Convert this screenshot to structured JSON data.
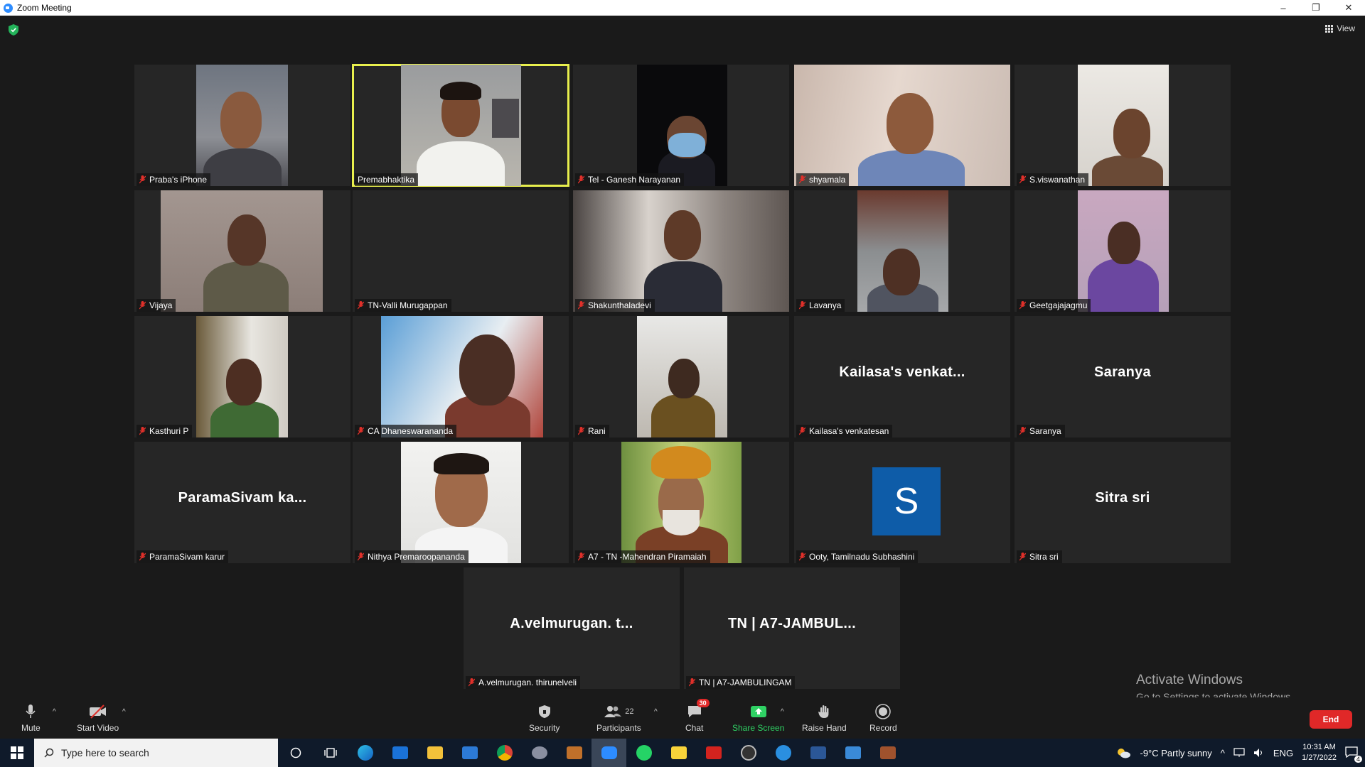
{
  "window": {
    "title": "Zoom Meeting",
    "controls": [
      "–",
      "❐",
      "✕"
    ]
  },
  "view_button": {
    "label": "View"
  },
  "tiles": [
    {
      "name": "Praba's iPhone"
    },
    {
      "name": "Premabhaktika",
      "active": true
    },
    {
      "name": "Tel - Ganesh Narayanan"
    },
    {
      "name": "shyamala"
    },
    {
      "name": "S.viswanathan"
    },
    {
      "name": "Vijaya"
    },
    {
      "name": "TN-Valli Murugappan"
    },
    {
      "name": "Shakunthaladevi"
    },
    {
      "name": "Lavanya"
    },
    {
      "name": "Geetgajajagmu"
    },
    {
      "name": "Kasthuri P"
    },
    {
      "name": "CA Dhaneswarananda"
    },
    {
      "name": "Rani"
    },
    {
      "name": "Kailasa's venkatesan",
      "display": "Kailasa's  venkat..."
    },
    {
      "name": "Saranya",
      "display": "Saranya"
    },
    {
      "name": "ParamaSivam karur",
      "display": "ParamaSivam  ka..."
    },
    {
      "name": "Nithya Premaroopananda"
    },
    {
      "name": "A7 - TN -Mahendran Piramaiah"
    },
    {
      "name": "Ooty, Tamilnadu Subhashini",
      "avatar": "S"
    },
    {
      "name": "Sitra sri",
      "display": "Sitra sri"
    },
    {
      "name": "A.velmurugan. thirunelveli",
      "display": "A.velmurugan.  t..."
    },
    {
      "name": "TN | A7-JAMBULINGAM",
      "display": "TN | A7-JAMBUL..."
    }
  ],
  "toolbar": {
    "mute": "Mute",
    "start_video": "Start Video",
    "security": "Security",
    "participants": "Participants",
    "participants_count": "22",
    "chat": "Chat",
    "chat_badge": "30",
    "share_screen": "Share Screen",
    "raise_hand": "Raise Hand",
    "record": "Record",
    "end": "End"
  },
  "watermark": {
    "line1": "Activate Windows",
    "line2": "Go to Settings to activate Windows."
  },
  "taskbar": {
    "search_placeholder": "Type here to search",
    "weather": "-9°C  Partly sunny",
    "lang": "ENG",
    "time": "10:31 AM",
    "date": "1/27/2022",
    "notifications": "4"
  },
  "colors": {
    "active_speaker": "#e8ef4d",
    "share_green": "#2fd164",
    "end_red": "#e02828",
    "avatar_blue": "#0e5ca8"
  }
}
